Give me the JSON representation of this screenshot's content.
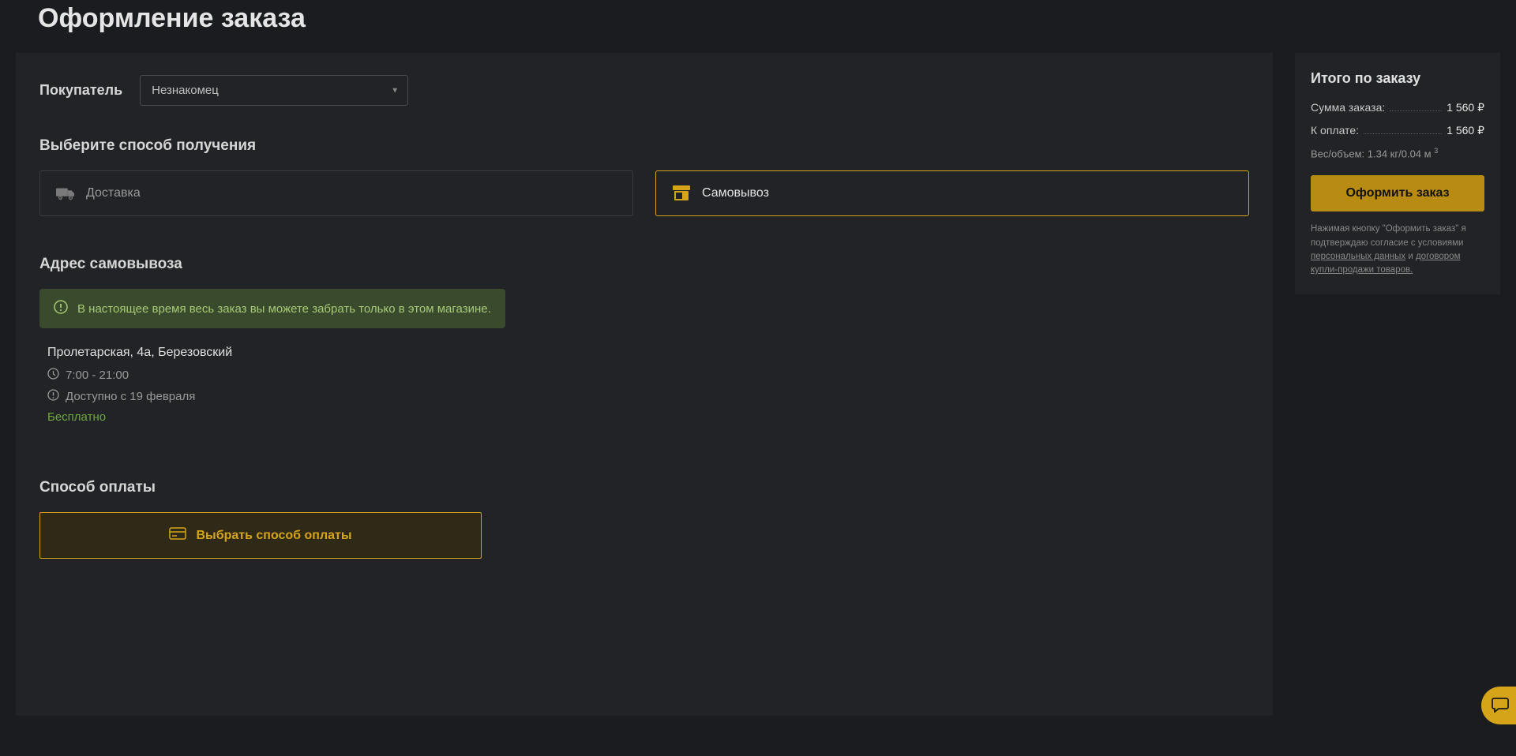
{
  "page_title": "Оформление заказа",
  "buyer": {
    "label": "Покупатель",
    "selected": "Незнакомец"
  },
  "delivery_section": {
    "title": "Выберите способ получения",
    "options": {
      "delivery": "Доставка",
      "pickup": "Самовывоз"
    }
  },
  "pickup_section": {
    "title": "Адрес самовывоза",
    "alert": "В настоящее время весь заказ вы можете забрать только в этом магазине.",
    "address": "Пролетарская, 4а, Березовский",
    "hours": "7:00 - 21:00",
    "available": "Доступно с 19 февраля",
    "price": "Бесплатно"
  },
  "payment_section": {
    "title": "Способ оплаты",
    "button": "Выбрать способ оплаты"
  },
  "summary": {
    "title": "Итого по заказу",
    "rows": {
      "order_sum_label": "Сумма заказа:",
      "order_sum_value": "1 560 ₽",
      "to_pay_label": "К оплате:",
      "to_pay_value": "1 560 ₽"
    },
    "weight_label": "Вес/объем: 1.34 кг/0.04 м",
    "weight_exp": "3",
    "submit": "Оформить заказ",
    "legal_prefix": "Нажимая кнопку \"Оформить заказ\" я подтверждаю согласие с условиями ",
    "legal_link1": "персональных данных",
    "legal_mid": " и ",
    "legal_link2": "договором купли-продажи товаров.",
    "legal_suffix": ""
  }
}
